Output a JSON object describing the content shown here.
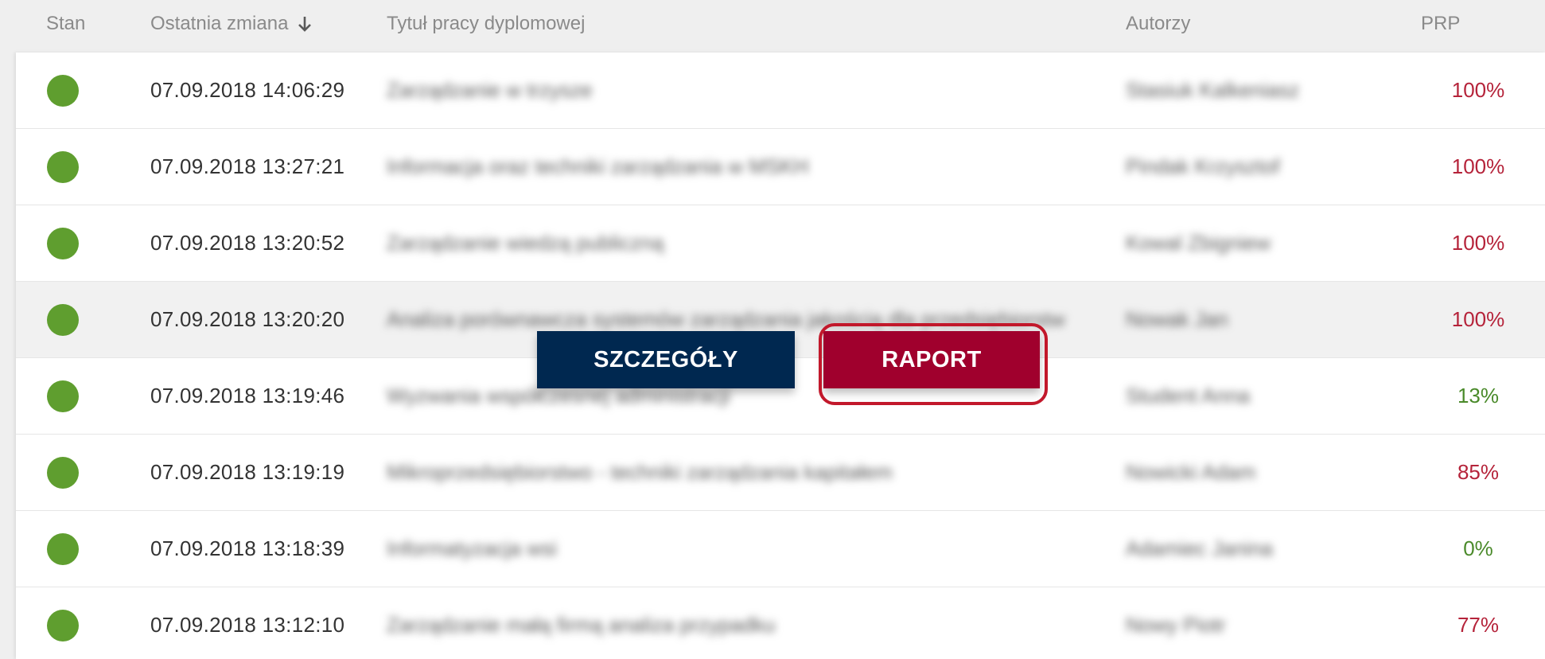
{
  "columns": {
    "status": "Stan",
    "last_change": "Ostatnia zmiana",
    "title": "Tytuł pracy dyplomowej",
    "authors": "Autorzy",
    "prp": "PRP"
  },
  "sort_icon": "arrow-down-icon",
  "rows": [
    {
      "status_color": "#5f9e2f",
      "date": "07.09.2018 14:06:29",
      "title": "Zarządzanie w trzysze",
      "author": "Stasiuk Kalkeniasz",
      "prp": "100%",
      "prp_color": "#b5233a"
    },
    {
      "status_color": "#5f9e2f",
      "date": "07.09.2018 13:27:21",
      "title": "Informacja oraz techniki zarządzania w MSKH",
      "author": "Pindak Krzysztof",
      "prp": "100%",
      "prp_color": "#b5233a"
    },
    {
      "status_color": "#5f9e2f",
      "date": "07.09.2018 13:20:52",
      "title": "Zarządzanie wiedzą publiczną",
      "author": "Kowal Zbigniew",
      "prp": "100%",
      "prp_color": "#b5233a"
    },
    {
      "status_color": "#5f9e2f",
      "date": "07.09.2018 13:20:20",
      "title": "Analiza porównawcza systemów zarządzania jakością dla przedsiębiorstw",
      "author": "Nowak Jan",
      "prp": "100%",
      "prp_color": "#b5233a"
    },
    {
      "status_color": "#5f9e2f",
      "date": "07.09.2018 13:19:46",
      "title": "Wyzwania współczesnej administracji",
      "author": "Student Anna",
      "prp": "13%",
      "prp_color": "#4a8a2a"
    },
    {
      "status_color": "#5f9e2f",
      "date": "07.09.2018 13:19:19",
      "title": "Mikroprzedsiębiorstwo - techniki zarządzania kapitałem",
      "author": "Nowicki Adam",
      "prp": "85%",
      "prp_color": "#b5233a"
    },
    {
      "status_color": "#5f9e2f",
      "date": "07.09.2018 13:18:39",
      "title": "Informatyzacja wsi",
      "author": "Adamiec Janina",
      "prp": "0%",
      "prp_color": "#4a8a2a"
    },
    {
      "status_color": "#5f9e2f",
      "date": "07.09.2018 13:12:10",
      "title": "Zarządzanie małą firmą analiza przypadku",
      "author": "Nowy Piotr",
      "prp": "77%",
      "prp_color": "#b5233a"
    }
  ],
  "actions": {
    "details_label": "SZCZEGÓŁY",
    "report_label": "RAPORT"
  },
  "colors": {
    "details_button": "#002850",
    "report_button": "#a0002d",
    "status_ok": "#5f9e2f"
  }
}
